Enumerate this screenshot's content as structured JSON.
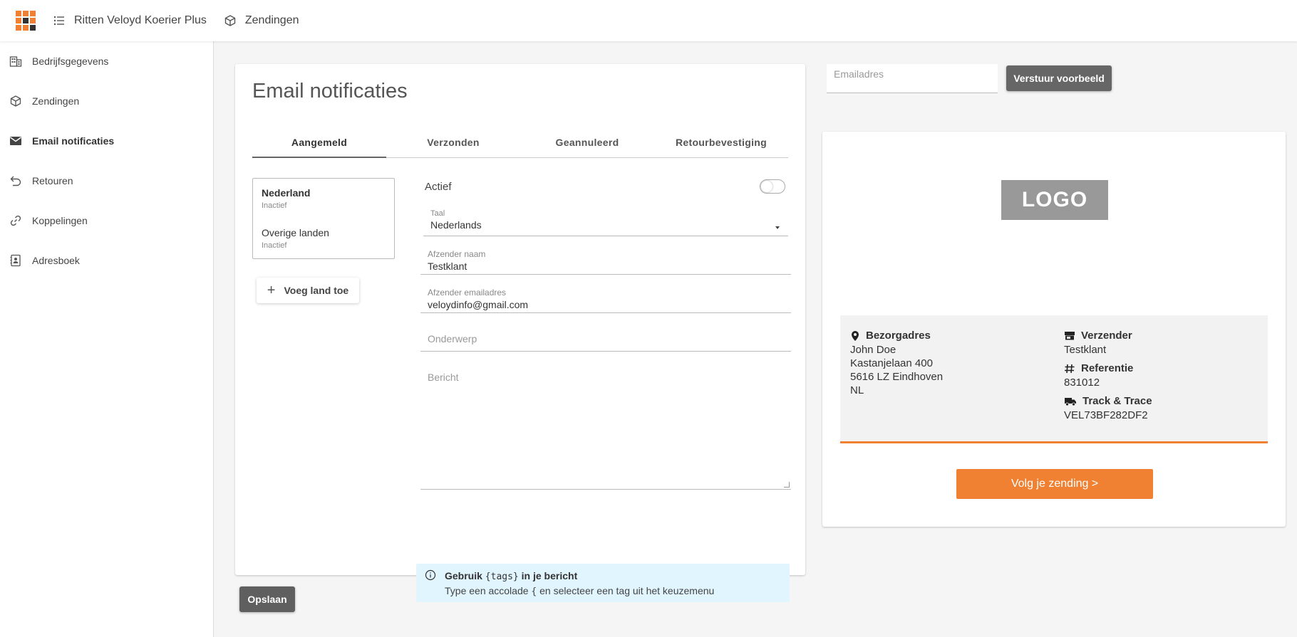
{
  "header": {
    "app_title": "Ritten Veloyd Koerier Plus",
    "section": "Zendingen",
    "grid_colors": [
      "#f08133",
      "#f08133",
      "#f08133",
      "#f08133",
      "#333333",
      "#f08133",
      "#f08133",
      "#f08133",
      "#333333"
    ]
  },
  "sidebar": {
    "items": [
      {
        "label": "Bedrijfsgegevens",
        "icon": "building-icon"
      },
      {
        "label": "Zendingen",
        "icon": "package-icon"
      },
      {
        "label": "Email notificaties",
        "icon": "mail-icon",
        "active": true
      },
      {
        "label": "Retouren",
        "icon": "undo-icon"
      },
      {
        "label": "Koppelingen",
        "icon": "link-icon"
      },
      {
        "label": "Adresboek",
        "icon": "address-book-icon"
      }
    ]
  },
  "main": {
    "title": "Email notificaties",
    "tabs": [
      {
        "label": "Aangemeld",
        "active": true
      },
      {
        "label": "Verzonden"
      },
      {
        "label": "Geannuleerd"
      },
      {
        "label": "Retourbevestiging"
      }
    ],
    "countries": [
      {
        "name": "Nederland",
        "status": "Inactief",
        "selected": true
      },
      {
        "name": "Overige landen",
        "status": "Inactief"
      }
    ],
    "add_country_label": "Voeg land toe",
    "form": {
      "actief_label": "Actief",
      "taal_label": "Taal",
      "taal_value": "Nederlands",
      "afzender_naam_label": "Afzender naam",
      "afzender_naam_value": "Testklant",
      "afzender_email_label": "Afzender emailadres",
      "afzender_email_value": "veloydinfo@gmail.com",
      "onderwerp_placeholder": "Onderwerp",
      "bericht_placeholder": "Bericht"
    },
    "info": {
      "title_pre": "Gebruik ",
      "title_code": "{tags}",
      "title_post": " in je bericht",
      "text_pre": "Type een accolade ",
      "text_code": "{",
      "text_post": " en selecteer een tag uit het keuzemenu"
    },
    "save_label": "Opslaan"
  },
  "preview": {
    "email_placeholder": "Emailadres",
    "send_label": "Verstuur voorbeeld",
    "logo_text": "LOGO",
    "bezorgadres": {
      "label": "Bezorgadres",
      "lines": [
        "John Doe",
        "Kastanjelaan 400",
        "5616 LZ Eindhoven",
        "NL"
      ]
    },
    "verzender": {
      "label": "Verzender",
      "value": "Testklant"
    },
    "referentie": {
      "label": "Referentie",
      "value": "831012"
    },
    "track": {
      "label": "Track & Trace",
      "value": "VEL73BF282DF2"
    },
    "track_button": "Volg je zending >",
    "accent_color": "#f08133"
  }
}
